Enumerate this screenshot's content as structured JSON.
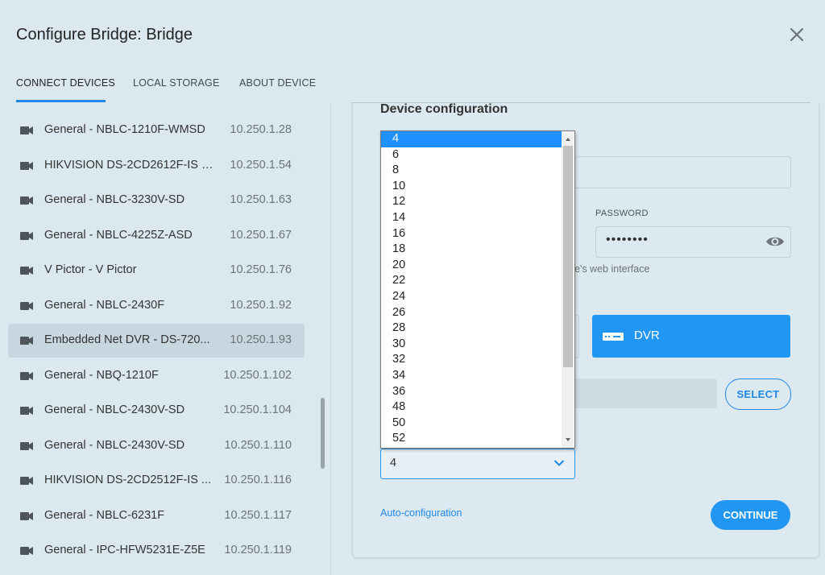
{
  "dialog": {
    "title": "Configure Bridge: Bridge"
  },
  "tabs": [
    {
      "label": "CONNECT DEVICES",
      "active": true
    },
    {
      "label": "LOCAL STORAGE",
      "active": false
    },
    {
      "label": "ABOUT DEVICE",
      "active": false
    }
  ],
  "devices": [
    {
      "name": "General - NBLC-1210F-WMSD",
      "ip": "10.250.1.28",
      "selected": false
    },
    {
      "name": "HIKVISION DS-2CD2612F-IS - ...",
      "ip": "10.250.1.54",
      "selected": false
    },
    {
      "name": "General - NBLC-3230V-SD",
      "ip": "10.250.1.63",
      "selected": false
    },
    {
      "name": "General - NBLC-4225Z-ASD",
      "ip": "10.250.1.67",
      "selected": false
    },
    {
      "name": "V Pictor - V Pictor",
      "ip": "10.250.1.76",
      "selected": false
    },
    {
      "name": "General - NBLC-2430F",
      "ip": "10.250.1.92",
      "selected": false
    },
    {
      "name": "Embedded Net DVR - DS-720...",
      "ip": "10.250.1.93",
      "selected": true
    },
    {
      "name": "General - NBQ-1210F",
      "ip": "10.250.1.102",
      "selected": false
    },
    {
      "name": "General - NBLC-2430V-SD",
      "ip": "10.250.1.104",
      "selected": false
    },
    {
      "name": "General - NBLC-2430V-SD",
      "ip": "10.250.1.110",
      "selected": false
    },
    {
      "name": "HIKVISION DS-2CD2512F-IS ...",
      "ip": "10.250.1.116",
      "selected": false
    },
    {
      "name": "General - NBLC-6231F",
      "ip": "10.250.1.117",
      "selected": false
    },
    {
      "name": "General - IPC-HFW5231E-Z5E",
      "ip": "10.250.1.119",
      "selected": false
    }
  ],
  "config": {
    "section_title": "Device configuration",
    "password_label": "PASSWORD",
    "password_value": "••••••••",
    "hint_text": "e's web interface",
    "dvr_label": "DVR",
    "select_label": "SELECT",
    "channels_value": "4",
    "auto_config_label": "Auto-configuration",
    "continue_label": "CONTINUE"
  },
  "dropdown": {
    "options": [
      "4",
      "6",
      "8",
      "10",
      "12",
      "14",
      "16",
      "18",
      "20",
      "22",
      "24",
      "26",
      "28",
      "30",
      "32",
      "34",
      "36",
      "48",
      "50",
      "52"
    ],
    "highlighted": "4"
  },
  "colors": {
    "accent": "#2196f3",
    "background": "#dbe8f0",
    "selected_row": "#c8d6df"
  }
}
